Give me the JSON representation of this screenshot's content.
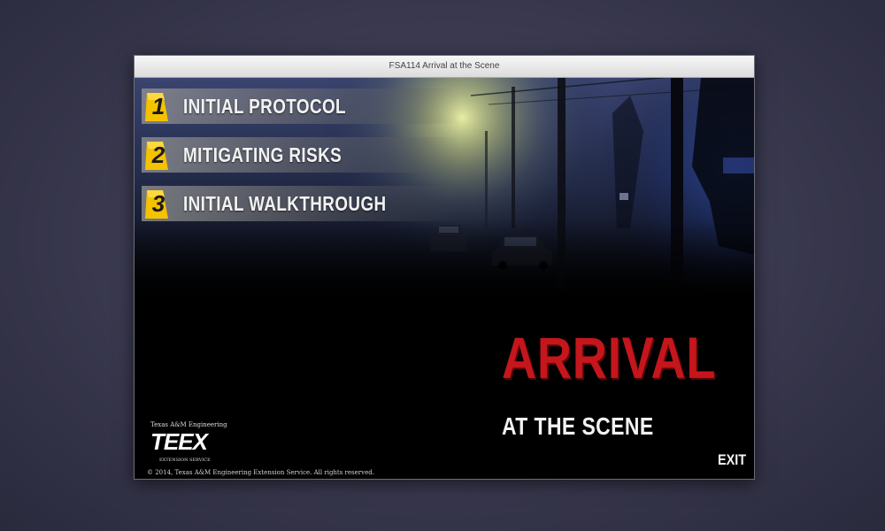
{
  "window": {
    "title": "FSA114 Arrival at the Scene"
  },
  "menu": {
    "items": [
      {
        "number": "1",
        "label": "INITIAL PROTOCOL"
      },
      {
        "number": "2",
        "label": "MITIGATING RISKS"
      },
      {
        "number": "3",
        "label": "INITIAL WALKTHROUGH"
      }
    ]
  },
  "title": {
    "main": "ARRIVAL",
    "sub": "AT THE SCENE"
  },
  "exit_label": "EXIT",
  "logo": {
    "top_text": "Texas A&M Engineering",
    "main_text": "TEEX",
    "bottom_text": "EXTENSION SERVICE"
  },
  "copyright": "© 2014, Texas A&M Engineering Extension Service. All rights reserved.",
  "colors": {
    "accent_red": "#c4161c",
    "marker_yellow": "#f5c200",
    "fog_yellow": "#e8f08a",
    "night_blue": "#1e2f6a"
  },
  "icons": {
    "markers": "evidence-marker-icon"
  }
}
